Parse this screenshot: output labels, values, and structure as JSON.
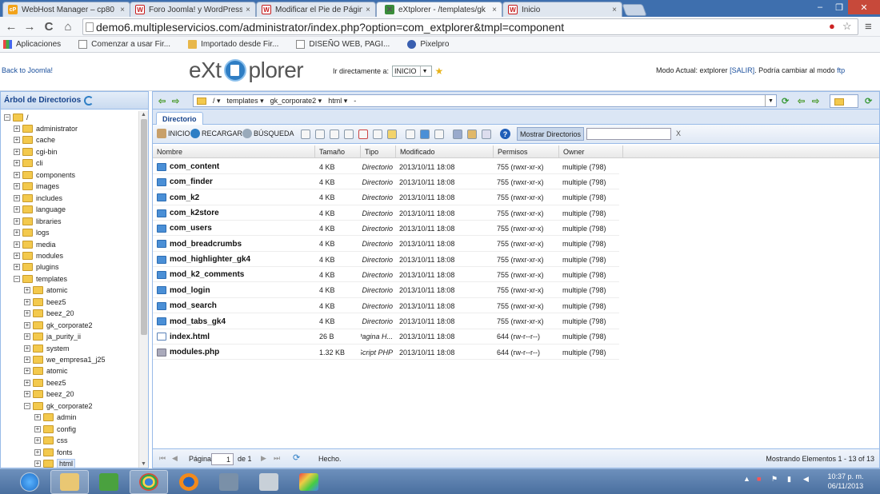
{
  "browser": {
    "tabs": [
      {
        "title": "WebHost Manager – cp80",
        "favicon": "cp"
      },
      {
        "title": "Foro Joomla! y WordPress",
        "favicon": "w"
      },
      {
        "title": "Modificar el Pie de Página",
        "favicon": "w"
      },
      {
        "title": "eXtplorer - /templates/gk",
        "favicon": "x"
      },
      {
        "title": "Inicio",
        "favicon": "w"
      }
    ],
    "tab_close": "×",
    "window_controls": {
      "minimize": "–",
      "maximize": "❐",
      "close": "✕"
    },
    "nav": {
      "back": "←",
      "forward": "→",
      "reload": "C",
      "home": "⌂"
    },
    "url": "demo6.multipleservicios.com/administrator/index.php?option=com_extplorer&tmpl=component",
    "menu": "≡",
    "bookmarks": [
      {
        "label": "Aplicaciones",
        "icon": "apps-grid-icon"
      },
      {
        "label": "Comenzar a usar Fir...",
        "icon": "page-icon"
      },
      {
        "label": "Importado desde Fir...",
        "icon": "folder-icon"
      },
      {
        "label": "DISEÑO WEB, PAGI...",
        "icon": "page-icon"
      },
      {
        "label": "Pixelpro",
        "icon": "pixelpro-icon"
      }
    ]
  },
  "app": {
    "back_link": "Back to Joomla!",
    "logo": {
      "left": "eXt",
      "right": "plorer"
    },
    "goto_label": "Ir directamente a:",
    "goto_value": "INICIO",
    "mode_text": "Modo Actual: extplorer",
    "mode_logout": "[SALIR]",
    "mode_change": ". Podría cambiar al modo",
    "mode_ftp": "ftp"
  },
  "tree": {
    "title": "Árbol de Directorios",
    "root": "/",
    "nodes": [
      {
        "label": "administrator",
        "level": 1,
        "expanded": false
      },
      {
        "label": "cache",
        "level": 1,
        "expanded": false
      },
      {
        "label": "cgi-bin",
        "level": 1,
        "expanded": false
      },
      {
        "label": "cli",
        "level": 1,
        "expanded": false
      },
      {
        "label": "components",
        "level": 1,
        "expanded": false
      },
      {
        "label": "images",
        "level": 1,
        "expanded": false
      },
      {
        "label": "includes",
        "level": 1,
        "expanded": false
      },
      {
        "label": "language",
        "level": 1,
        "expanded": false
      },
      {
        "label": "libraries",
        "level": 1,
        "expanded": false
      },
      {
        "label": "logs",
        "level": 1,
        "expanded": false
      },
      {
        "label": "media",
        "level": 1,
        "expanded": false
      },
      {
        "label": "modules",
        "level": 1,
        "expanded": false
      },
      {
        "label": "plugins",
        "level": 1,
        "expanded": false
      },
      {
        "label": "templates",
        "level": 1,
        "expanded": true
      },
      {
        "label": "atomic",
        "level": 2,
        "expanded": false
      },
      {
        "label": "beez5",
        "level": 2,
        "expanded": false
      },
      {
        "label": "beez_20",
        "level": 2,
        "expanded": false
      },
      {
        "label": "gk_corporate2",
        "level": 2,
        "expanded": false
      },
      {
        "label": "ja_purity_ii",
        "level": 2,
        "expanded": false
      },
      {
        "label": "system",
        "level": 2,
        "expanded": false
      },
      {
        "label": "we_empresa1_j25",
        "level": 2,
        "expanded": false
      },
      {
        "label": "atomic",
        "level": 2,
        "expanded": false
      },
      {
        "label": "beez5",
        "level": 2,
        "expanded": false
      },
      {
        "label": "beez_20",
        "level": 2,
        "expanded": false
      },
      {
        "label": "gk_corporate2",
        "level": 2,
        "expanded": true
      },
      {
        "label": "admin",
        "level": 3,
        "expanded": false
      },
      {
        "label": "config",
        "level": 3,
        "expanded": false
      },
      {
        "label": "css",
        "level": 3,
        "expanded": false
      },
      {
        "label": "fonts",
        "level": 3,
        "expanded": false
      },
      {
        "label": "html",
        "level": 3,
        "expanded": false,
        "selected": true
      }
    ]
  },
  "pathbar": {
    "segments": [
      "/",
      "templates",
      "gk_corporate2",
      "html",
      "-"
    ]
  },
  "panel": {
    "tab_label": "Directorio",
    "actions": {
      "home": "INICIO",
      "reload": "RECARGAR",
      "search": "BÚSQUEDA"
    },
    "show_dirs": "Mostrar Directorios",
    "filter_clear": "X",
    "help": "?",
    "columns": [
      "Nombre",
      "Tamaño",
      "Tipo",
      "Modificado",
      "Permisos",
      "Owner"
    ],
    "rows": [
      {
        "name": "com_content",
        "size": "4 KB",
        "type": "Directorio",
        "modified": "2013/10/11 18:08",
        "perms": "755 (rwxr-xr-x)",
        "owner": "multiple (798)",
        "kind": "dir"
      },
      {
        "name": "com_finder",
        "size": "4 KB",
        "type": "Directorio",
        "modified": "2013/10/11 18:08",
        "perms": "755 (rwxr-xr-x)",
        "owner": "multiple (798)",
        "kind": "dir"
      },
      {
        "name": "com_k2",
        "size": "4 KB",
        "type": "Directorio",
        "modified": "2013/10/11 18:08",
        "perms": "755 (rwxr-xr-x)",
        "owner": "multiple (798)",
        "kind": "dir"
      },
      {
        "name": "com_k2store",
        "size": "4 KB",
        "type": "Directorio",
        "modified": "2013/10/11 18:08",
        "perms": "755 (rwxr-xr-x)",
        "owner": "multiple (798)",
        "kind": "dir"
      },
      {
        "name": "com_users",
        "size": "4 KB",
        "type": "Directorio",
        "modified": "2013/10/11 18:08",
        "perms": "755 (rwxr-xr-x)",
        "owner": "multiple (798)",
        "kind": "dir"
      },
      {
        "name": "mod_breadcrumbs",
        "size": "4 KB",
        "type": "Directorio",
        "modified": "2013/10/11 18:08",
        "perms": "755 (rwxr-xr-x)",
        "owner": "multiple (798)",
        "kind": "dir"
      },
      {
        "name": "mod_highlighter_gk4",
        "size": "4 KB",
        "type": "Directorio",
        "modified": "2013/10/11 18:08",
        "perms": "755 (rwxr-xr-x)",
        "owner": "multiple (798)",
        "kind": "dir"
      },
      {
        "name": "mod_k2_comments",
        "size": "4 KB",
        "type": "Directorio",
        "modified": "2013/10/11 18:08",
        "perms": "755 (rwxr-xr-x)",
        "owner": "multiple (798)",
        "kind": "dir"
      },
      {
        "name": "mod_login",
        "size": "4 KB",
        "type": "Directorio",
        "modified": "2013/10/11 18:08",
        "perms": "755 (rwxr-xr-x)",
        "owner": "multiple (798)",
        "kind": "dir"
      },
      {
        "name": "mod_search",
        "size": "4 KB",
        "type": "Directorio",
        "modified": "2013/10/11 18:08",
        "perms": "755 (rwxr-xr-x)",
        "owner": "multiple (798)",
        "kind": "dir"
      },
      {
        "name": "mod_tabs_gk4",
        "size": "4 KB",
        "type": "Directorio",
        "modified": "2013/10/11 18:08",
        "perms": "755 (rwxr-xr-x)",
        "owner": "multiple (798)",
        "kind": "dir"
      },
      {
        "name": "index.html",
        "size": "26 B",
        "type": "Pagina H...",
        "modified": "2013/10/11 18:08",
        "perms": "644 (rw-r--r--)",
        "owner": "multiple (798)",
        "kind": "html"
      },
      {
        "name": "modules.php",
        "size": "1.32 KB",
        "type": "Script PHP",
        "modified": "2013/10/11 18:08",
        "perms": "644 (rw-r--r--)",
        "owner": "multiple (798)",
        "kind": "php"
      }
    ],
    "pager": {
      "page_label": "Página",
      "page_value": "1",
      "of_label": "de 1",
      "status": "Hecho.",
      "summary": "Mostrando Elementos 1 - 13 of 13"
    }
  },
  "taskbar": {
    "clock_time": "10:37 p. m.",
    "clock_date": "06/11/2013"
  }
}
